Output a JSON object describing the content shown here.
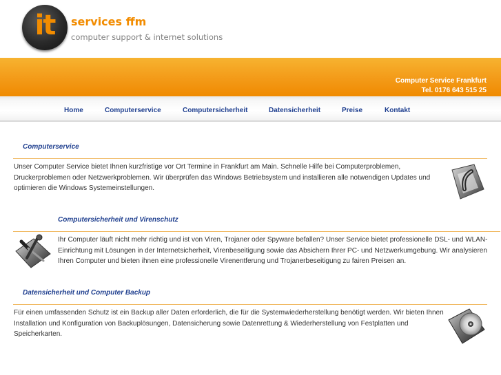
{
  "header": {
    "logo_text": "it",
    "brand": "services ffm",
    "slogan": "computer support & internet solutions"
  },
  "banner": {
    "title": "Computer Service Frankfurt",
    "phone": "Tel. 0176 643 515 25"
  },
  "nav": {
    "items": [
      {
        "label": "Home"
      },
      {
        "label": "Computerservice"
      },
      {
        "label": "Computersicherheit"
      },
      {
        "label": "Datensicherheit"
      },
      {
        "label": "Preise"
      },
      {
        "label": "Kontakt"
      }
    ]
  },
  "sections": [
    {
      "title": "Computerservice",
      "lines": [
        "Unser Computer Service bietet Ihnen kurzfristige vor Ort Termine in Frankfurt am Main. Schnelle Hilfe bei Computerproblemen,",
        "Druckerproblemen oder Netzwerkproblemen. Wir überprüfen das Windows Betriebsystem und installieren alle notwendigen Updates und",
        "optimieren die Windows Systemeinstellungen."
      ],
      "icon": "screwdriver-tool-icon"
    },
    {
      "title": "Computersicherheit und Virenschutz",
      "lines": [
        "Ihr Computer läuft nicht mehr richtig und ist von Viren, Trojaner oder Spyware befallen? Unser Service bietet professionelle DSL- und WLAN-",
        "Einrichtung mit Lösungen in der Internetsicherheit, Virenbeseitigung sowie das Absichern Ihrer PC- und Netzwerkumgebung. Wir analysieren",
        "Ihren Computer und bieten ihnen eine professionelle Virenentferung und Trojanerbeseitigung zu fairen Preisen an."
      ],
      "icon": "security-tools-icon"
    },
    {
      "title": "Datensicherheit und Computer Backup",
      "lines": [
        "Für einen umfassenden Schutz ist ein Backup aller Daten erforderlich, die für die Systemwiederherstellung benötigt werden. Wir bieten Ihnen",
        "Installation und Konfiguration von Backuplösungen, Datensicherung sowie Datenrettung & Wiederherstellung von Festplatten und",
        "Speicherkarten."
      ],
      "icon": "backup-disc-icon"
    }
  ],
  "colors": {
    "accent": "#f28c00",
    "link": "#1f3f8f",
    "rule": "#f0b860"
  }
}
